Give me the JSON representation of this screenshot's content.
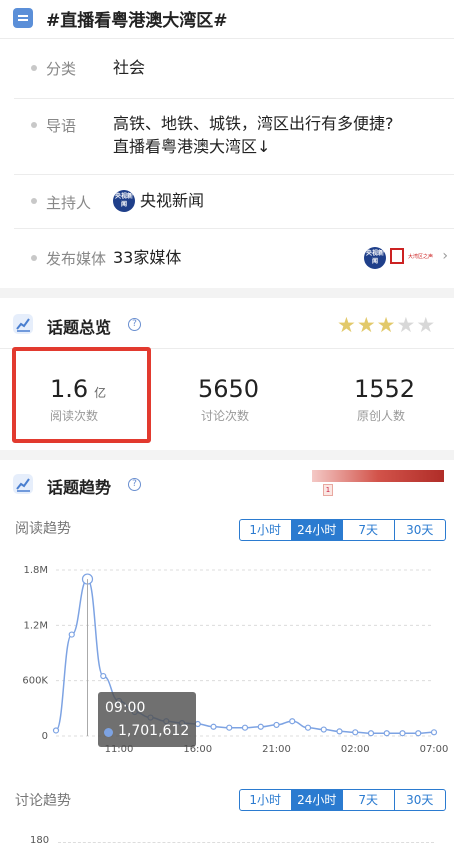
{
  "header": {
    "title": "#直播看粤港澳大湾区#"
  },
  "info": {
    "category": {
      "label": "分类",
      "value": "社会"
    },
    "guide": {
      "label": "导语",
      "line1": "高铁、地铁、城铁，湾区出行有多便捷?",
      "line2": "直播看粤港澳大湾区↓"
    },
    "host": {
      "label": "主持人",
      "value": "央视新闻",
      "logo_text": "央视新闻"
    },
    "media": {
      "label": "发布媒体",
      "value": "33家媒体",
      "logo1_text": "央视新闻",
      "logo2_text": "大湾区之声",
      "chevron": "›"
    }
  },
  "overview": {
    "title": "话题总览",
    "help": "?",
    "rating": 3,
    "rating_max": 5,
    "stats": [
      {
        "value": "1.6",
        "unit": "亿",
        "label": "阅读次数"
      },
      {
        "value": "5650",
        "label": "讨论次数"
      },
      {
        "value": "1552",
        "label": "原创人数"
      }
    ]
  },
  "trend": {
    "title": "话题趋势",
    "help": "?",
    "heat_marker": "1",
    "reading": {
      "subtitle": "阅读趋势",
      "tabs": [
        "1小时",
        "24小时",
        "7天",
        "30天"
      ],
      "active_tab": 1
    },
    "discussion": {
      "subtitle": "讨论趋势",
      "tabs": [
        "1小时",
        "24小时",
        "7天",
        "30天"
      ],
      "active_tab": 1,
      "y_tick_top": "180"
    }
  },
  "chart_data": {
    "type": "line",
    "title": "",
    "xlabel": "",
    "ylabel": "",
    "y_ticks": [
      "0",
      "600K",
      "1.2M",
      "1.8M"
    ],
    "ylim": [
      0,
      1800000
    ],
    "x_ticks": [
      "11:00",
      "16:00",
      "21:00",
      "02:00",
      "07:00"
    ],
    "x": [
      "07:00",
      "08:00",
      "09:00",
      "10:00",
      "11:00",
      "12:00",
      "13:00",
      "14:00",
      "15:00",
      "16:00",
      "17:00",
      "18:00",
      "19:00",
      "20:00",
      "21:00",
      "22:00",
      "23:00",
      "00:00",
      "01:00",
      "02:00",
      "03:00",
      "04:00",
      "05:00",
      "06:00",
      "07:00"
    ],
    "series": [
      {
        "values": [
          60000,
          1100000,
          1701612,
          650000,
          380000,
          260000,
          200000,
          160000,
          140000,
          130000,
          100000,
          90000,
          90000,
          100000,
          120000,
          160000,
          90000,
          70000,
          50000,
          40000,
          30000,
          30000,
          30000,
          30000,
          40000
        ]
      }
    ],
    "tooltip": {
      "time": "09:00",
      "value": "1,701,612"
    },
    "highlight_index": 2,
    "color": "#7da3e3"
  }
}
